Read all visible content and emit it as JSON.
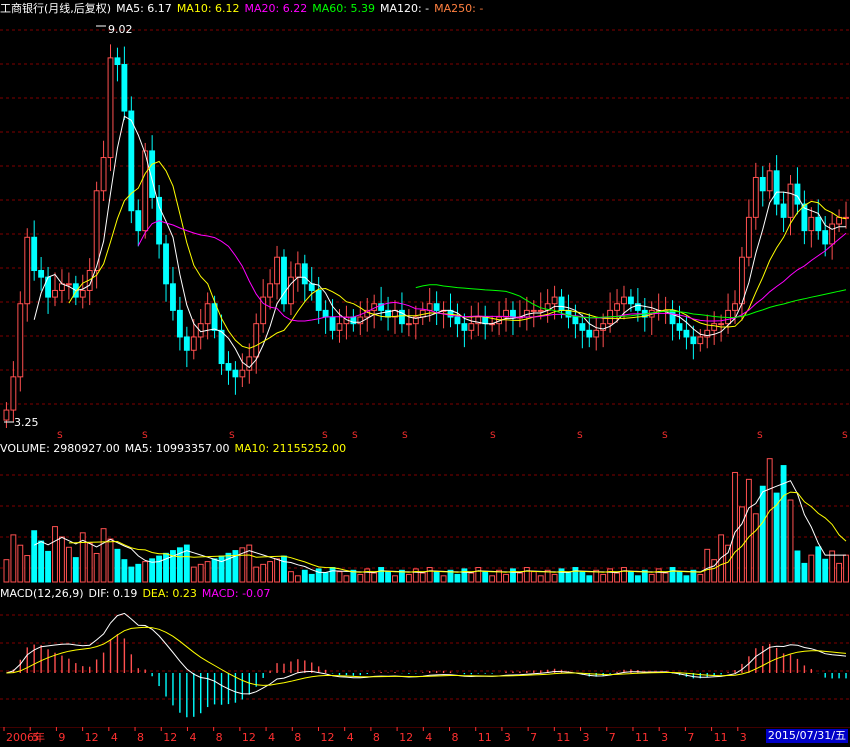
{
  "price_panel": {
    "title": "工商银行(月线,后复权)",
    "ma5": "MA5: 6.17",
    "ma10": "MA10: 6.12",
    "ma20": "MA20: 6.22",
    "ma60": "MA60: 5.39",
    "ma120": "MA120: -",
    "ma250": "MA250: -",
    "high_label": "9.02",
    "low_label": "3.25",
    "dividend_marker": "S",
    "colors": {
      "ma5": "#ffffff",
      "ma10": "#ffff00",
      "ma20": "#ff00ff",
      "ma60": "#00ff00",
      "ma120": "#ffffff",
      "ma250": "#ff8040",
      "up": "#ff5050",
      "down": "#00ffff",
      "grid": "#800000"
    }
  },
  "volume_panel": {
    "volume": "VOLUME: 2980927.00",
    "ma5": "MA5: 10993357.00",
    "ma10": "MA10: 21155252.00"
  },
  "macd_panel": {
    "title": "MACD(12,26,9)",
    "dif": "DIF: 0.19",
    "dea": "DEA: 0.23",
    "macd": "MACD: -0.07"
  },
  "time_axis": {
    "labels": [
      "2006年",
      "5",
      "9",
      "12",
      "4",
      "8",
      "12",
      "4",
      "8",
      "12",
      "4",
      "8",
      "12",
      "4",
      "8",
      "12",
      "4",
      "8",
      "11",
      "3",
      "7",
      "11",
      "3",
      "7",
      "11",
      "3",
      "7",
      "11",
      "3"
    ],
    "current_date": "2015/07/31/五"
  },
  "chart_data": {
    "type": "candlestick",
    "series": [
      {
        "name": "MA5",
        "value": 6.17
      },
      {
        "name": "MA10",
        "value": 6.12
      },
      {
        "name": "MA20",
        "value": 6.22
      },
      {
        "name": "MA60",
        "value": 5.39
      }
    ],
    "price_high": 9.02,
    "price_low": 3.25,
    "closes": [
      3.3,
      3.8,
      4.9,
      5.9,
      5.4,
      5.3,
      5.0,
      5.1,
      5.2,
      5.2,
      5.0,
      5.1,
      5.4,
      6.6,
      7.1,
      8.6,
      8.5,
      7.8,
      6.3,
      6.0,
      7.2,
      6.5,
      5.8,
      5.2,
      4.8,
      4.4,
      4.2,
      4.4,
      4.6,
      4.9,
      4.5,
      4.0,
      3.9,
      3.8,
      3.9,
      4.1,
      4.6,
      5.0,
      5.2,
      5.6,
      4.9,
      5.3,
      5.5,
      5.2,
      5.1,
      4.8,
      4.7,
      4.5,
      4.6,
      4.7,
      4.6,
      4.7,
      4.8,
      4.9,
      4.8,
      4.7,
      4.8,
      4.6,
      4.6,
      4.7,
      4.8,
      4.9,
      4.8,
      4.8,
      4.7,
      4.6,
      4.5,
      4.6,
      4.7,
      4.6,
      4.6,
      4.7,
      4.8,
      4.7,
      4.7,
      4.8,
      4.8,
      4.8,
      4.9,
      5.0,
      4.8,
      4.7,
      4.6,
      4.5,
      4.4,
      4.5,
      4.6,
      4.8,
      4.9,
      5.0,
      4.9,
      4.8,
      4.7,
      4.8,
      4.8,
      4.8,
      4.6,
      4.5,
      4.4,
      4.3,
      4.4,
      4.5,
      4.6,
      4.6,
      4.8,
      4.9,
      5.6,
      6.2,
      6.8,
      6.6,
      6.9,
      6.4,
      6.2,
      6.7,
      6.4,
      6.0,
      6.2,
      6.0,
      5.8,
      6.1,
      6.2,
      6.2
    ],
    "volume_ma5": 10993357.0,
    "volume_ma10": 21155252.0,
    "macd": {
      "dif": 0.19,
      "dea": 0.23,
      "macd": -0.07
    }
  }
}
